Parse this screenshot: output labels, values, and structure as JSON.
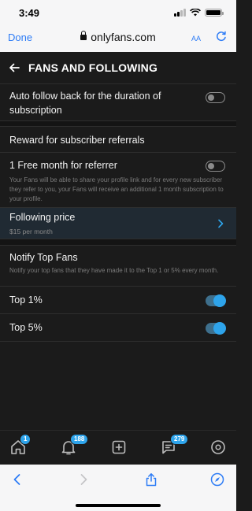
{
  "status_bar": {
    "time": "3:49"
  },
  "browser": {
    "done_label": "Done",
    "url": "onlyfans.com",
    "text_size_label": "AA"
  },
  "page": {
    "title": "FANS AND FOLLOWING"
  },
  "settings": {
    "auto_follow": {
      "label": "Auto follow back for the duration of subscription",
      "enabled": false
    },
    "referral_section_title": "Reward for subscriber referrals",
    "free_month": {
      "label": "1 Free month for referrer",
      "description": "Your Fans will be able to share your profile link and for every new subscriber they refer to you, your Fans will receive an additional 1 month subscription to your profile.",
      "enabled": false
    },
    "following_price": {
      "label": "Following price",
      "value": "$15 per month"
    },
    "notify_top_fans": {
      "title": "Notify Top Fans",
      "description": "Notify your top fans that they have made it to the Top 1 or 5% every month."
    },
    "top_1": {
      "label": "Top 1%",
      "enabled": true
    },
    "top_5": {
      "label": "Top 5%",
      "enabled": true
    }
  },
  "tabbar": {
    "home_badge": "1",
    "notifications_badge": "188",
    "messages_badge": "279"
  },
  "colors": {
    "accent": "#2ea4eb",
    "safari_blue": "#2d7cf6",
    "background": "#1b1b1b"
  }
}
